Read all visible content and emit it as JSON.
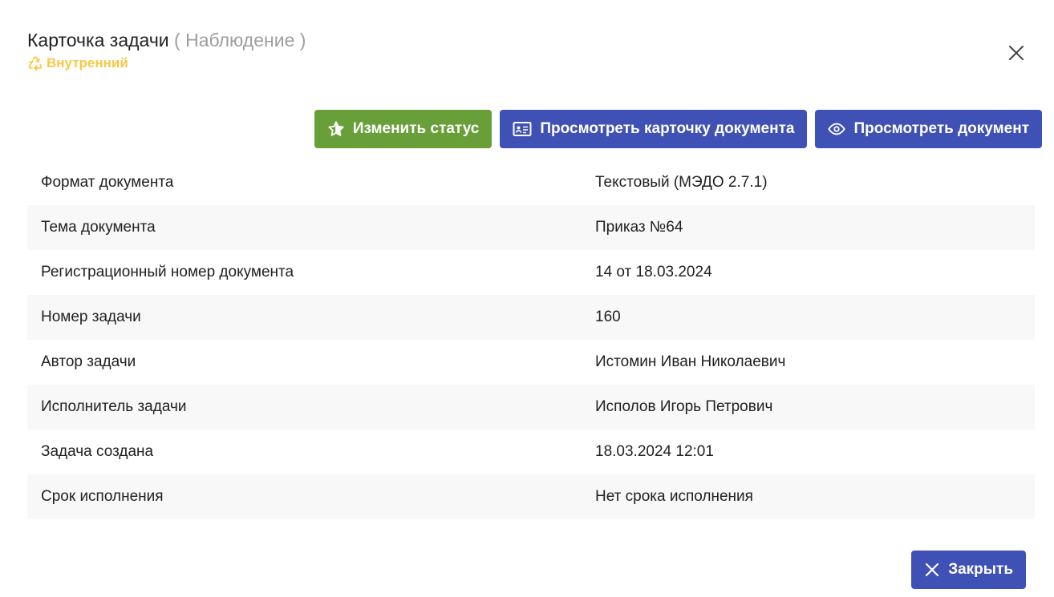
{
  "dialog": {
    "title": "Карточка задачи",
    "title_sub": "( Наблюдение )",
    "badge": "Внутренний",
    "close_icon": "close-icon"
  },
  "actions": {
    "change_status": "Изменить статус",
    "view_card": "Просмотреть карточку документа",
    "view_document": "Просмотреть документ"
  },
  "details": [
    {
      "label": "Формат документа",
      "value": "Текстовый (МЭДО 2.7.1)"
    },
    {
      "label": "Тема документа",
      "value": "Приказ №64"
    },
    {
      "label": "Регистрационный номер документа",
      "value": "14 от 18.03.2024"
    },
    {
      "label": "Номер задачи",
      "value": "160"
    },
    {
      "label": "Автор задачи",
      "value": "Истомин Иван Николаевич"
    },
    {
      "label": "Исполнитель задачи",
      "value": "Исполов Игорь Петрович"
    },
    {
      "label": "Задача создана",
      "value": "18.03.2024 12:01"
    },
    {
      "label": "Срок исполнения",
      "value": "Нет срока исполнения"
    }
  ],
  "footer": {
    "close_label": "Закрыть"
  },
  "colors": {
    "green": "#689f38",
    "indigo": "#3f51b5",
    "badge_yellow": "#f7c948",
    "muted": "#9e9e9e"
  }
}
